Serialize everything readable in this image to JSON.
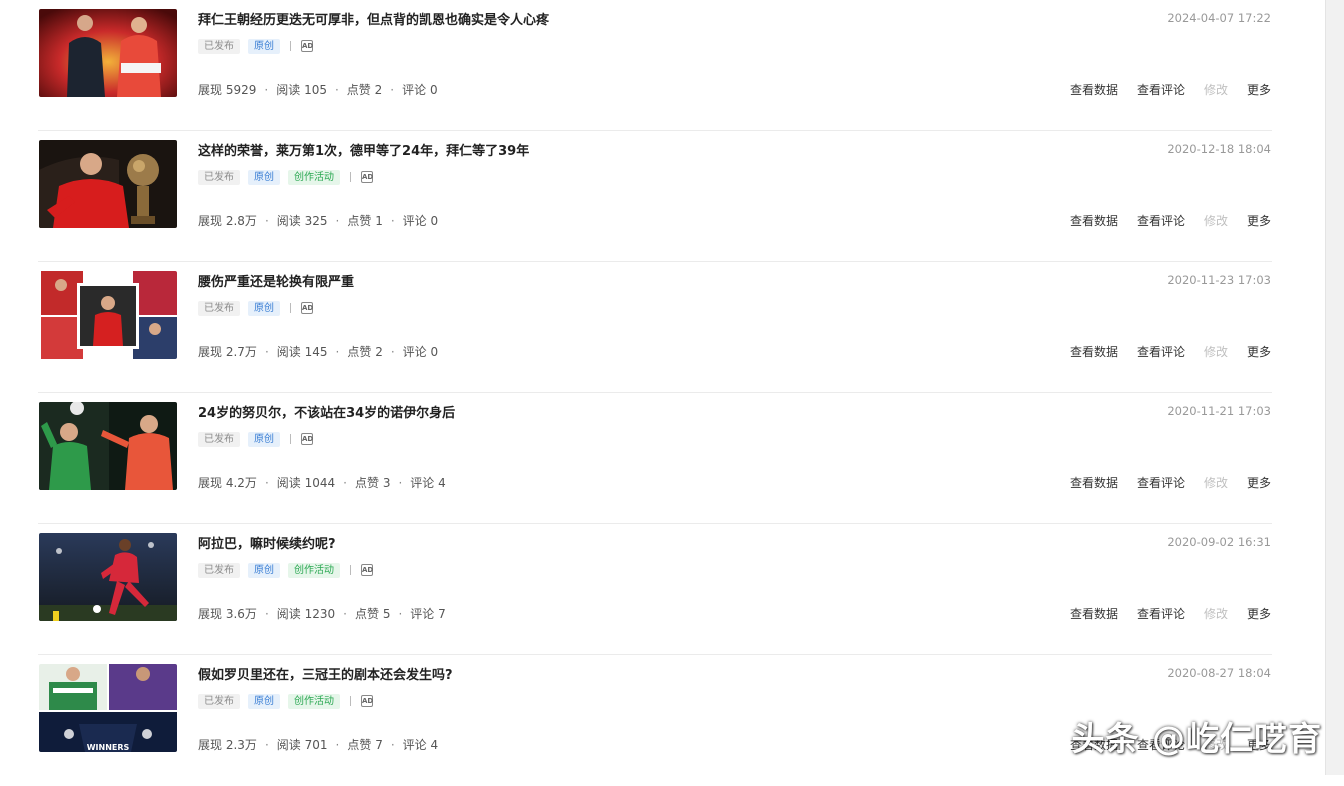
{
  "stat_labels": {
    "impressions": "展现",
    "reads": "阅读",
    "likes": "点赞",
    "comments": "评论"
  },
  "actions": {
    "view_data": "查看数据",
    "view_comments": "查看评论",
    "edit": "修改",
    "more": "更多"
  },
  "ad_icon": "AD",
  "articles": [
    {
      "title": "拜仁王朝经历更迭无可厚非，但点背的凯恩也确实是令人心疼",
      "date": "2024-04-07 17:22",
      "tags": [
        {
          "label": "已发布",
          "kind": "grey"
        },
        {
          "label": "原创",
          "kind": "blue"
        }
      ],
      "impressions": "5929",
      "reads": "105",
      "likes": "2",
      "comments": "0"
    },
    {
      "title": "这样的荣誉，莱万第1次，德甲等了24年，拜仁等了39年",
      "date": "2020-12-18 18:04",
      "tags": [
        {
          "label": "已发布",
          "kind": "grey"
        },
        {
          "label": "原创",
          "kind": "blue"
        },
        {
          "label": "创作活动",
          "kind": "green"
        }
      ],
      "impressions": "2.8万",
      "reads": "325",
      "likes": "1",
      "comments": "0"
    },
    {
      "title": "腰伤严重还是轮换有限严重",
      "date": "2020-11-23 17:03",
      "tags": [
        {
          "label": "已发布",
          "kind": "grey"
        },
        {
          "label": "原创",
          "kind": "blue"
        }
      ],
      "impressions": "2.7万",
      "reads": "145",
      "likes": "2",
      "comments": "0"
    },
    {
      "title": "24岁的努贝尔，不该站在34岁的诺伊尔身后",
      "date": "2020-11-21 17:03",
      "tags": [
        {
          "label": "已发布",
          "kind": "grey"
        },
        {
          "label": "原创",
          "kind": "blue"
        }
      ],
      "impressions": "4.2万",
      "reads": "1044",
      "likes": "3",
      "comments": "4"
    },
    {
      "title": "阿拉巴，嘛时候续约呢?",
      "date": "2020-09-02 16:31",
      "tags": [
        {
          "label": "已发布",
          "kind": "grey"
        },
        {
          "label": "原创",
          "kind": "blue"
        },
        {
          "label": "创作活动",
          "kind": "green"
        }
      ],
      "impressions": "3.6万",
      "reads": "1230",
      "likes": "5",
      "comments": "7"
    },
    {
      "title": "假如罗贝里还在，三冠王的剧本还会发生吗?",
      "date": "2020-08-27 18:04",
      "tags": [
        {
          "label": "已发布",
          "kind": "grey"
        },
        {
          "label": "原创",
          "kind": "blue"
        },
        {
          "label": "创作活动",
          "kind": "green"
        }
      ],
      "impressions": "2.3万",
      "reads": "701",
      "likes": "7",
      "comments": "4"
    }
  ],
  "watermark": "头条 @屹仁呓育",
  "thumb_text": {
    "winners": "WINNERS"
  }
}
